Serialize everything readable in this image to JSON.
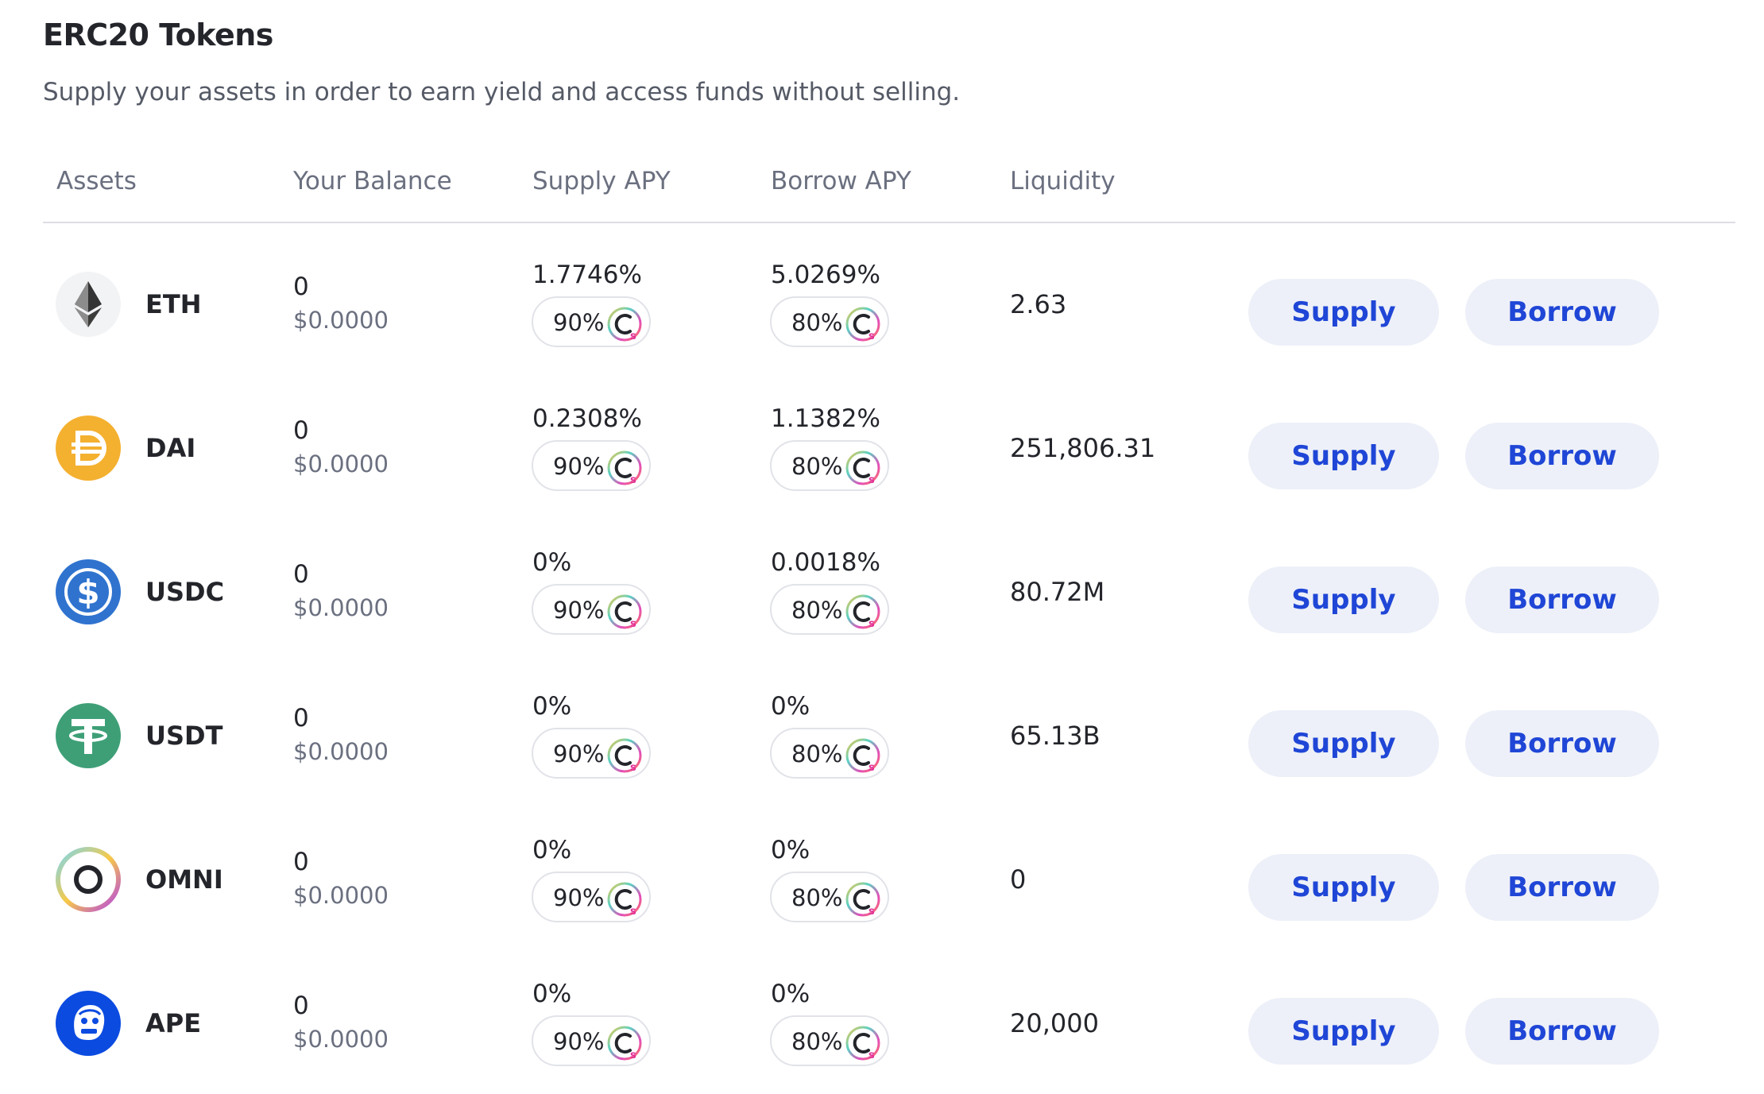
{
  "section": {
    "title": "ERC20 Tokens",
    "subtitle": "Supply your assets in order to earn yield and access funds without selling."
  },
  "table": {
    "headers": [
      "Assets",
      "Your Balance",
      "Supply APY",
      "Borrow APY",
      "Liquidity"
    ],
    "supply_label": "Supply",
    "borrow_label": "Borrow",
    "rows": [
      {
        "asset": "ETH",
        "icon": "eth-icon",
        "balance": "0",
        "balance_usd": "$0.0000",
        "supply_apy": "1.7746%",
        "supply_pill": "90%",
        "borrow_apy": "5.0269%",
        "borrow_pill": "80%",
        "liquidity": "2.63"
      },
      {
        "asset": "DAI",
        "icon": "dai-icon",
        "balance": "0",
        "balance_usd": "$0.0000",
        "supply_apy": "0.2308%",
        "supply_pill": "90%",
        "borrow_apy": "1.1382%",
        "borrow_pill": "80%",
        "liquidity": "251,806.31"
      },
      {
        "asset": "USDC",
        "icon": "usdc-icon",
        "balance": "0",
        "balance_usd": "$0.0000",
        "supply_apy": "0%",
        "supply_pill": "90%",
        "borrow_apy": "0.0018%",
        "borrow_pill": "80%",
        "liquidity": "80.72M"
      },
      {
        "asset": "USDT",
        "icon": "usdt-icon",
        "balance": "0",
        "balance_usd": "$0.0000",
        "supply_apy": "0%",
        "supply_pill": "90%",
        "borrow_apy": "0%",
        "borrow_pill": "80%",
        "liquidity": "65.13B"
      },
      {
        "asset": "OMNI",
        "icon": "omni-icon",
        "balance": "0",
        "balance_usd": "$0.0000",
        "supply_apy": "0%",
        "supply_pill": "90%",
        "borrow_apy": "0%",
        "borrow_pill": "80%",
        "liquidity": "0"
      },
      {
        "asset": "APE",
        "icon": "ape-icon",
        "balance": "0",
        "balance_usd": "$0.0000",
        "supply_apy": "0%",
        "supply_pill": "90%",
        "borrow_apy": "0%",
        "borrow_pill": "80%",
        "liquidity": "20,000"
      }
    ]
  },
  "colors": {
    "button_bg": "#edf0f8",
    "button_text": "#1f46d6",
    "dai": "#f4b02f",
    "usdc": "#2f73cf",
    "usdt": "#3e9f77",
    "ape": "#0b4be0"
  }
}
